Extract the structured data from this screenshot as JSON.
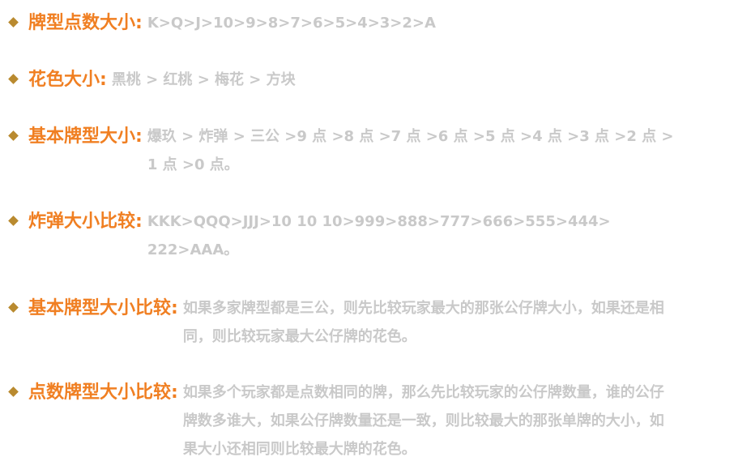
{
  "rules": [
    {
      "label": "牌型点数大小:",
      "text": "K>Q>J>10>9>8>7>6>5>4>3>2>A"
    },
    {
      "label": "花色大小:",
      "text": "黑桃 > 红桃 > 梅花 > 方块"
    },
    {
      "label": "基本牌型大小:",
      "text": "爆玖 > 炸弹 > 三公 >9 点 >8 点 >7 点 >6 点 >5 点 >4 点 >3 点 >2 点 > 1 点 >0 点。"
    },
    {
      "label": "炸弹大小比较:",
      "text": "KKK>QQQ>JJJ>10 10 10>999>888>777>666>555>444> 222>AAA。"
    },
    {
      "label": "基本牌型大小比较:",
      "text": "如果多家牌型都是三公，则先比较玩家最大的那张公仔牌大小，如果还是相同，则比较玩家最大公仔牌的花色。"
    },
    {
      "label": "点数牌型大小比较:",
      "text": "如果多个玩家都是点数相同的牌，那么先比较玩家的公仔牌数量，谁的公仔牌数多谁大，如果公仔牌数量还是一致，则比较最大的那张单牌的大小，如果大小还相同则比较最大牌的花色。"
    }
  ]
}
